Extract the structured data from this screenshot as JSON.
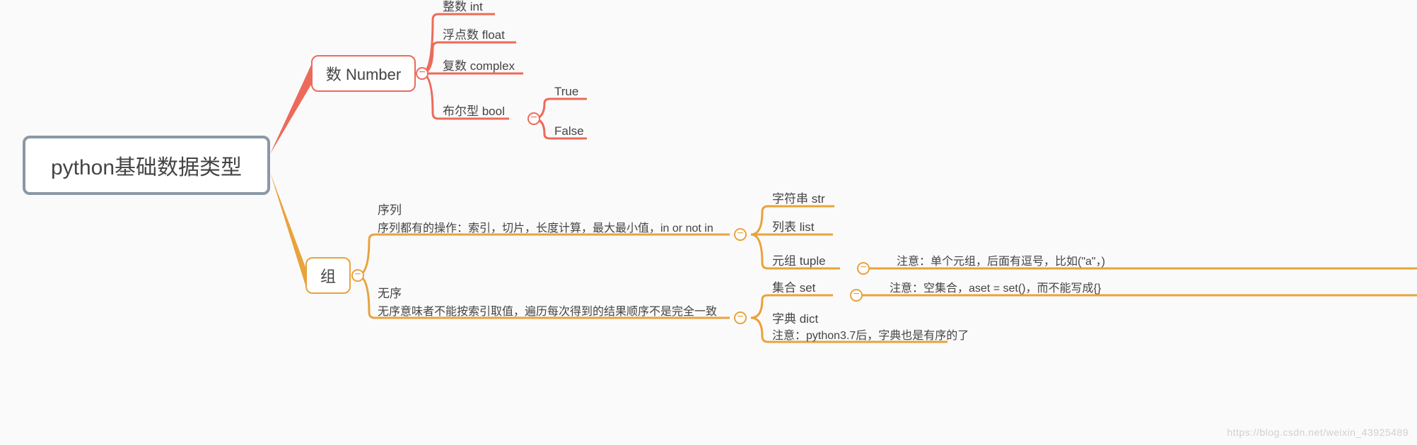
{
  "root": {
    "label": "python基础数据类型"
  },
  "number": {
    "label": "数 Number",
    "children": {
      "int": "整数 int",
      "float": "浮点数 float",
      "complex": "复数 complex",
      "bool": {
        "label": "布尔型 bool",
        "children": {
          "true": "True",
          "false": "False"
        }
      }
    }
  },
  "group": {
    "label": "组",
    "sections": {
      "sequence": {
        "title": "序列",
        "desc": "序列都有的操作：索引，切片，长度计算，最大最小值，in or not in",
        "children": {
          "str": "字符串 str",
          "list": "列表 list",
          "tuple": {
            "label": "元组 tuple",
            "note": "注意：单个元组，后面有逗号，比如(\"a\"，)"
          }
        }
      },
      "unordered": {
        "title": "无序",
        "desc": "无序意味者不能按索引取值，遍历每次得到的结果顺序不是完全一致",
        "children": {
          "set": {
            "label": "集合 set",
            "note": "注意：空集合，aset = set()，而不能写成{}"
          },
          "dict": {
            "label": "字典 dict",
            "note": "注意：python3.7后，字典也是有序的了"
          }
        }
      }
    }
  },
  "icons": {
    "collapse": "−"
  },
  "colors": {
    "red": "#ed6a5a",
    "yellow": "#e8a33c",
    "border": "#8a98a6"
  },
  "watermark": "https://blog.csdn.net/weixin_43925489"
}
